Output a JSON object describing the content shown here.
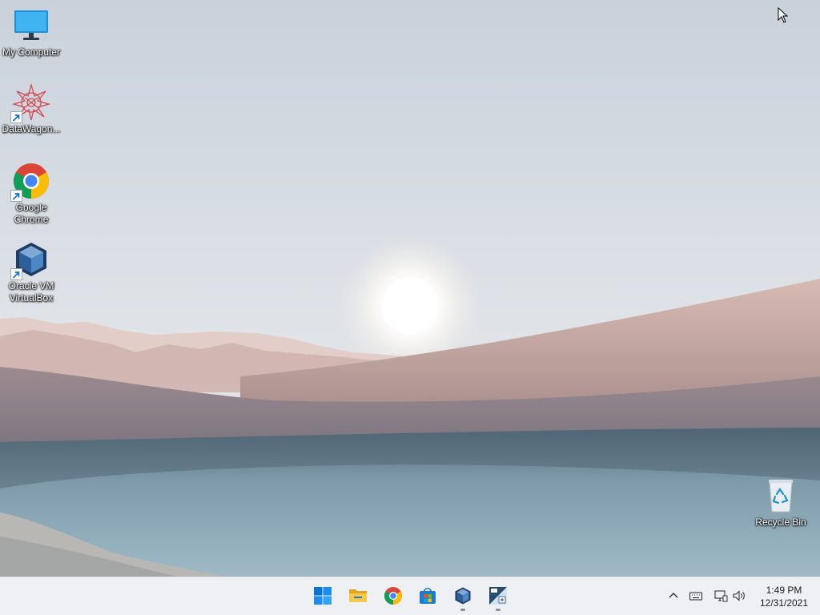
{
  "desktop": {
    "icons": [
      {
        "id": "my-computer",
        "label": "My Computer",
        "shortcut": false,
        "icon": "monitor-icon"
      },
      {
        "id": "datawagon",
        "label": "DataWagon...",
        "shortcut": true,
        "icon": "datawagon-icon"
      },
      {
        "id": "google-chrome",
        "label": "Google Chrome",
        "shortcut": true,
        "icon": "chrome-icon"
      },
      {
        "id": "virtualbox",
        "label": "Oracle VM VirtualBox",
        "shortcut": true,
        "icon": "virtualbox-icon"
      },
      {
        "id": "recycle-bin",
        "label": "Recycle Bin",
        "shortcut": false,
        "icon": "recycle-bin-icon"
      }
    ]
  },
  "taskbar": {
    "apps": [
      {
        "name": "Start",
        "icon": "windows-start-icon",
        "running": false
      },
      {
        "name": "File Explorer",
        "icon": "folder-icon",
        "running": false
      },
      {
        "name": "Google Chrome",
        "icon": "chrome-icon",
        "running": false
      },
      {
        "name": "Microsoft Store",
        "icon": "store-icon",
        "running": false
      },
      {
        "name": "Oracle VM VirtualBox",
        "icon": "virtualbox-icon",
        "running": true
      },
      {
        "name": "Calculator",
        "icon": "calculator-icon",
        "running": true
      }
    ],
    "tray": {
      "icons": [
        "chevron-up-icon",
        "keyboard-icon",
        "network-icon",
        "volume-icon"
      ]
    },
    "clock": {
      "time": "1:49 PM",
      "date": "12/31/2021"
    }
  },
  "colors": {
    "taskbar_bg": "#eef0f3",
    "sky_top": "#cfd6de",
    "sand": "#c9a9a3",
    "water": "#7e9fb0"
  }
}
